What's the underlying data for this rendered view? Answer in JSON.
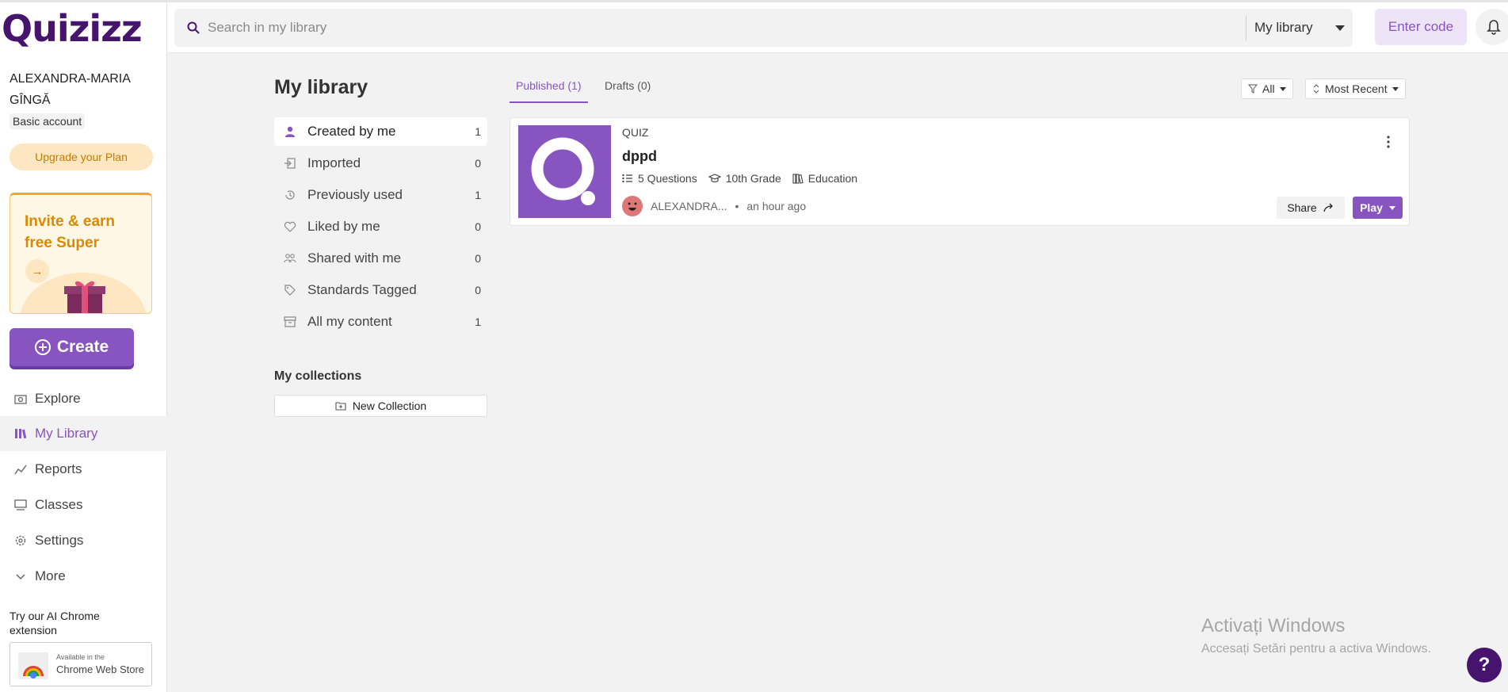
{
  "brand": {
    "logo_text": "Quizizz",
    "accent": "#8854c0",
    "dark": "#46146c"
  },
  "header": {
    "search_placeholder": "Search in my library",
    "scope_label": "My library",
    "enter_code_label": "Enter code",
    "icons": [
      "search-icon",
      "chevron-down-icon",
      "bell-icon"
    ]
  },
  "user": {
    "name": "ALEXANDRA-MARIA GÎNGĂ",
    "account_type": "Basic account",
    "upgrade_label": "Upgrade your Plan"
  },
  "invite": {
    "text": "Invite & earn free Super",
    "arrow": "→"
  },
  "create_label": "Create",
  "nav": [
    {
      "label": "Explore",
      "icon": "explore-icon",
      "active": false
    },
    {
      "label": "My Library",
      "icon": "library-icon",
      "active": true
    },
    {
      "label": "Reports",
      "icon": "reports-icon",
      "active": false
    },
    {
      "label": "Classes",
      "icon": "classes-icon",
      "active": false
    },
    {
      "label": "Settings",
      "icon": "gear-icon",
      "active": false
    },
    {
      "label": "More",
      "icon": "chevron-down-icon",
      "active": false
    }
  ],
  "extension": {
    "promo": "Try our AI Chrome extension",
    "badge_small": "Available in the",
    "badge_big": "Chrome Web Store"
  },
  "library": {
    "title": "My library",
    "filters": [
      {
        "label": "Created by me",
        "count": "1",
        "icon": "user-icon",
        "active": true
      },
      {
        "label": "Imported",
        "count": "0",
        "icon": "import-icon",
        "active": false
      },
      {
        "label": "Previously used",
        "count": "1",
        "icon": "history-icon",
        "active": false
      },
      {
        "label": "Liked by me",
        "count": "0",
        "icon": "heart-icon",
        "active": false
      },
      {
        "label": "Shared with me",
        "count": "0",
        "icon": "people-icon",
        "active": false
      },
      {
        "label": "Standards Tagged",
        "count": "0",
        "icon": "tag-icon",
        "active": false
      },
      {
        "label": "All my content",
        "count": "1",
        "icon": "archive-icon",
        "active": false
      }
    ],
    "collections_title": "My collections",
    "new_collection_label": "New Collection"
  },
  "tabs": [
    {
      "label": "Published (1)",
      "active": true
    },
    {
      "label": "Drafts (0)",
      "active": false
    }
  ],
  "toolbar": {
    "filter_label": "All",
    "sort_label": "Most Recent"
  },
  "quiz_card": {
    "type": "QUIZ",
    "title": "dppd",
    "questions": "5 Questions",
    "grade": "10th Grade",
    "subject": "Education",
    "author": "ALEXANDRA...",
    "separator": "•",
    "time": "an hour ago",
    "share_label": "Share",
    "play_label": "Play"
  },
  "windows_notice": {
    "title": "Activați Windows",
    "subtitle": "Accesați Setări pentru a activa Windows."
  },
  "help_label": "?"
}
